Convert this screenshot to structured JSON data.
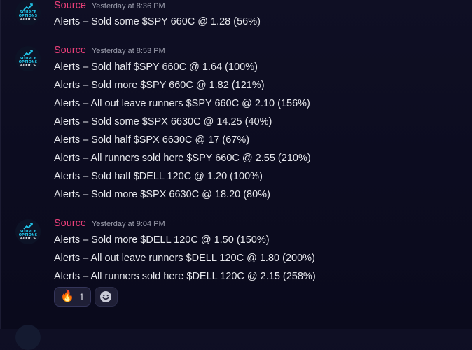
{
  "messages": [
    {
      "author": "Source",
      "timestamp": "Yesterday at 8:36 PM",
      "avatar_text": [
        "SOURCE",
        "OPTIONS",
        "ALERTS"
      ],
      "lines": [
        "Alerts – Sold some $SPY 660C @ 1.28 (56%)"
      ]
    },
    {
      "author": "Source",
      "timestamp": "Yesterday at 8:53 PM",
      "avatar_text": [
        "SOURCE",
        "OPTIONS",
        "ALERTS"
      ],
      "lines": [
        "Alerts – Sold half $SPY 660C @ 1.64 (100%)",
        "Alerts – Sold more $SPY 660C @ 1.82 (121%)",
        "Alerts – All out leave runners $SPY 660C @ 2.10 (156%)",
        "Alerts – Sold some $SPX 6630C @ 14.25 (40%)",
        "Alerts – Sold half $SPX 6630C @ 17 (67%)",
        "Alerts – All runners sold here $SPY 660C @ 2.55 (210%)",
        "Alerts – Sold half $DELL 120C @ 1.20 (100%)",
        "Alerts – Sold more $SPX 6630C @ 18.20 (80%)"
      ]
    },
    {
      "author": "Source",
      "timestamp": "Yesterday at 9:04 PM",
      "avatar_text": [
        "SOURCE",
        "OPTIONS",
        "ALERTS"
      ],
      "lines": [
        "Alerts – Sold more $DELL 120C @ 1.50 (150%)",
        "Alerts – All out leave runners $DELL 120C @ 1.80 (200%)",
        "Alerts – All runners sold here $DELL 120C @ 2.15 (258%)"
      ]
    }
  ],
  "reactions": [
    {
      "emoji": "🔥",
      "icon": "fire-icon",
      "count": "1"
    }
  ],
  "colors": {
    "author": "#ec407a",
    "timestamp": "#9b9dac",
    "text": "#e6e7ec",
    "background": "#0f0f24",
    "logo_accent": "#22c6ea"
  }
}
